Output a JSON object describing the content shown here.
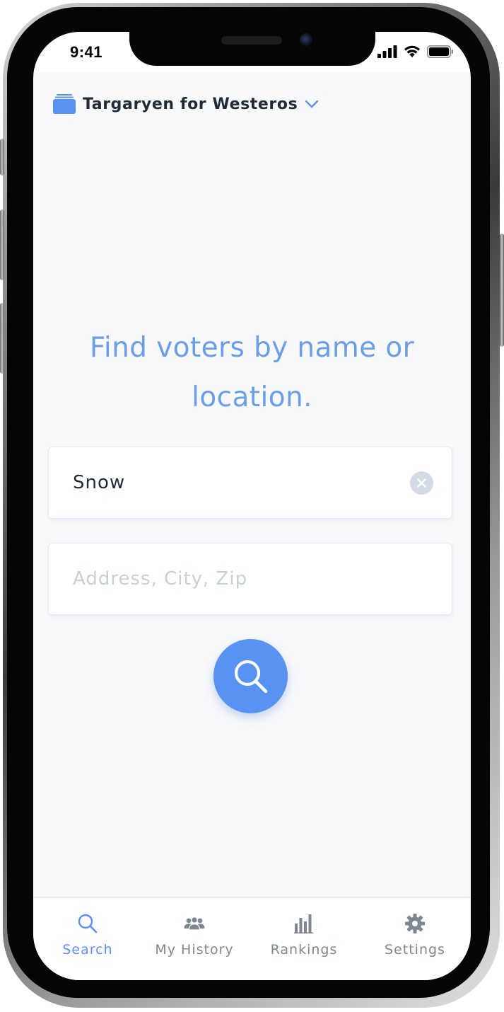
{
  "status_bar": {
    "time": "9:41"
  },
  "header": {
    "org_name": "Targaryen for Westeros",
    "icon": "folder-stack-icon",
    "dropdown_icon": "chevron-down-icon"
  },
  "main": {
    "headline": "Find voters by name or location.",
    "name_field": {
      "value": "Snow",
      "placeholder": ""
    },
    "location_field": {
      "value": "",
      "placeholder": "Address, City, Zip"
    },
    "search_button_icon": "search-icon"
  },
  "tab_bar": {
    "tabs": [
      {
        "label": "Search",
        "icon": "search-icon",
        "active": true
      },
      {
        "label": "My History",
        "icon": "people-icon",
        "active": false
      },
      {
        "label": "Rankings",
        "icon": "bar-chart-icon",
        "active": false
      },
      {
        "label": "Settings",
        "icon": "gear-icon",
        "active": false
      }
    ]
  },
  "colors": {
    "accent": "#5893f4",
    "headline": "#6a9ee9",
    "text_dark": "#1f2b3a",
    "tab_inactive": "#7d8791",
    "background": "#f8f9fb"
  }
}
